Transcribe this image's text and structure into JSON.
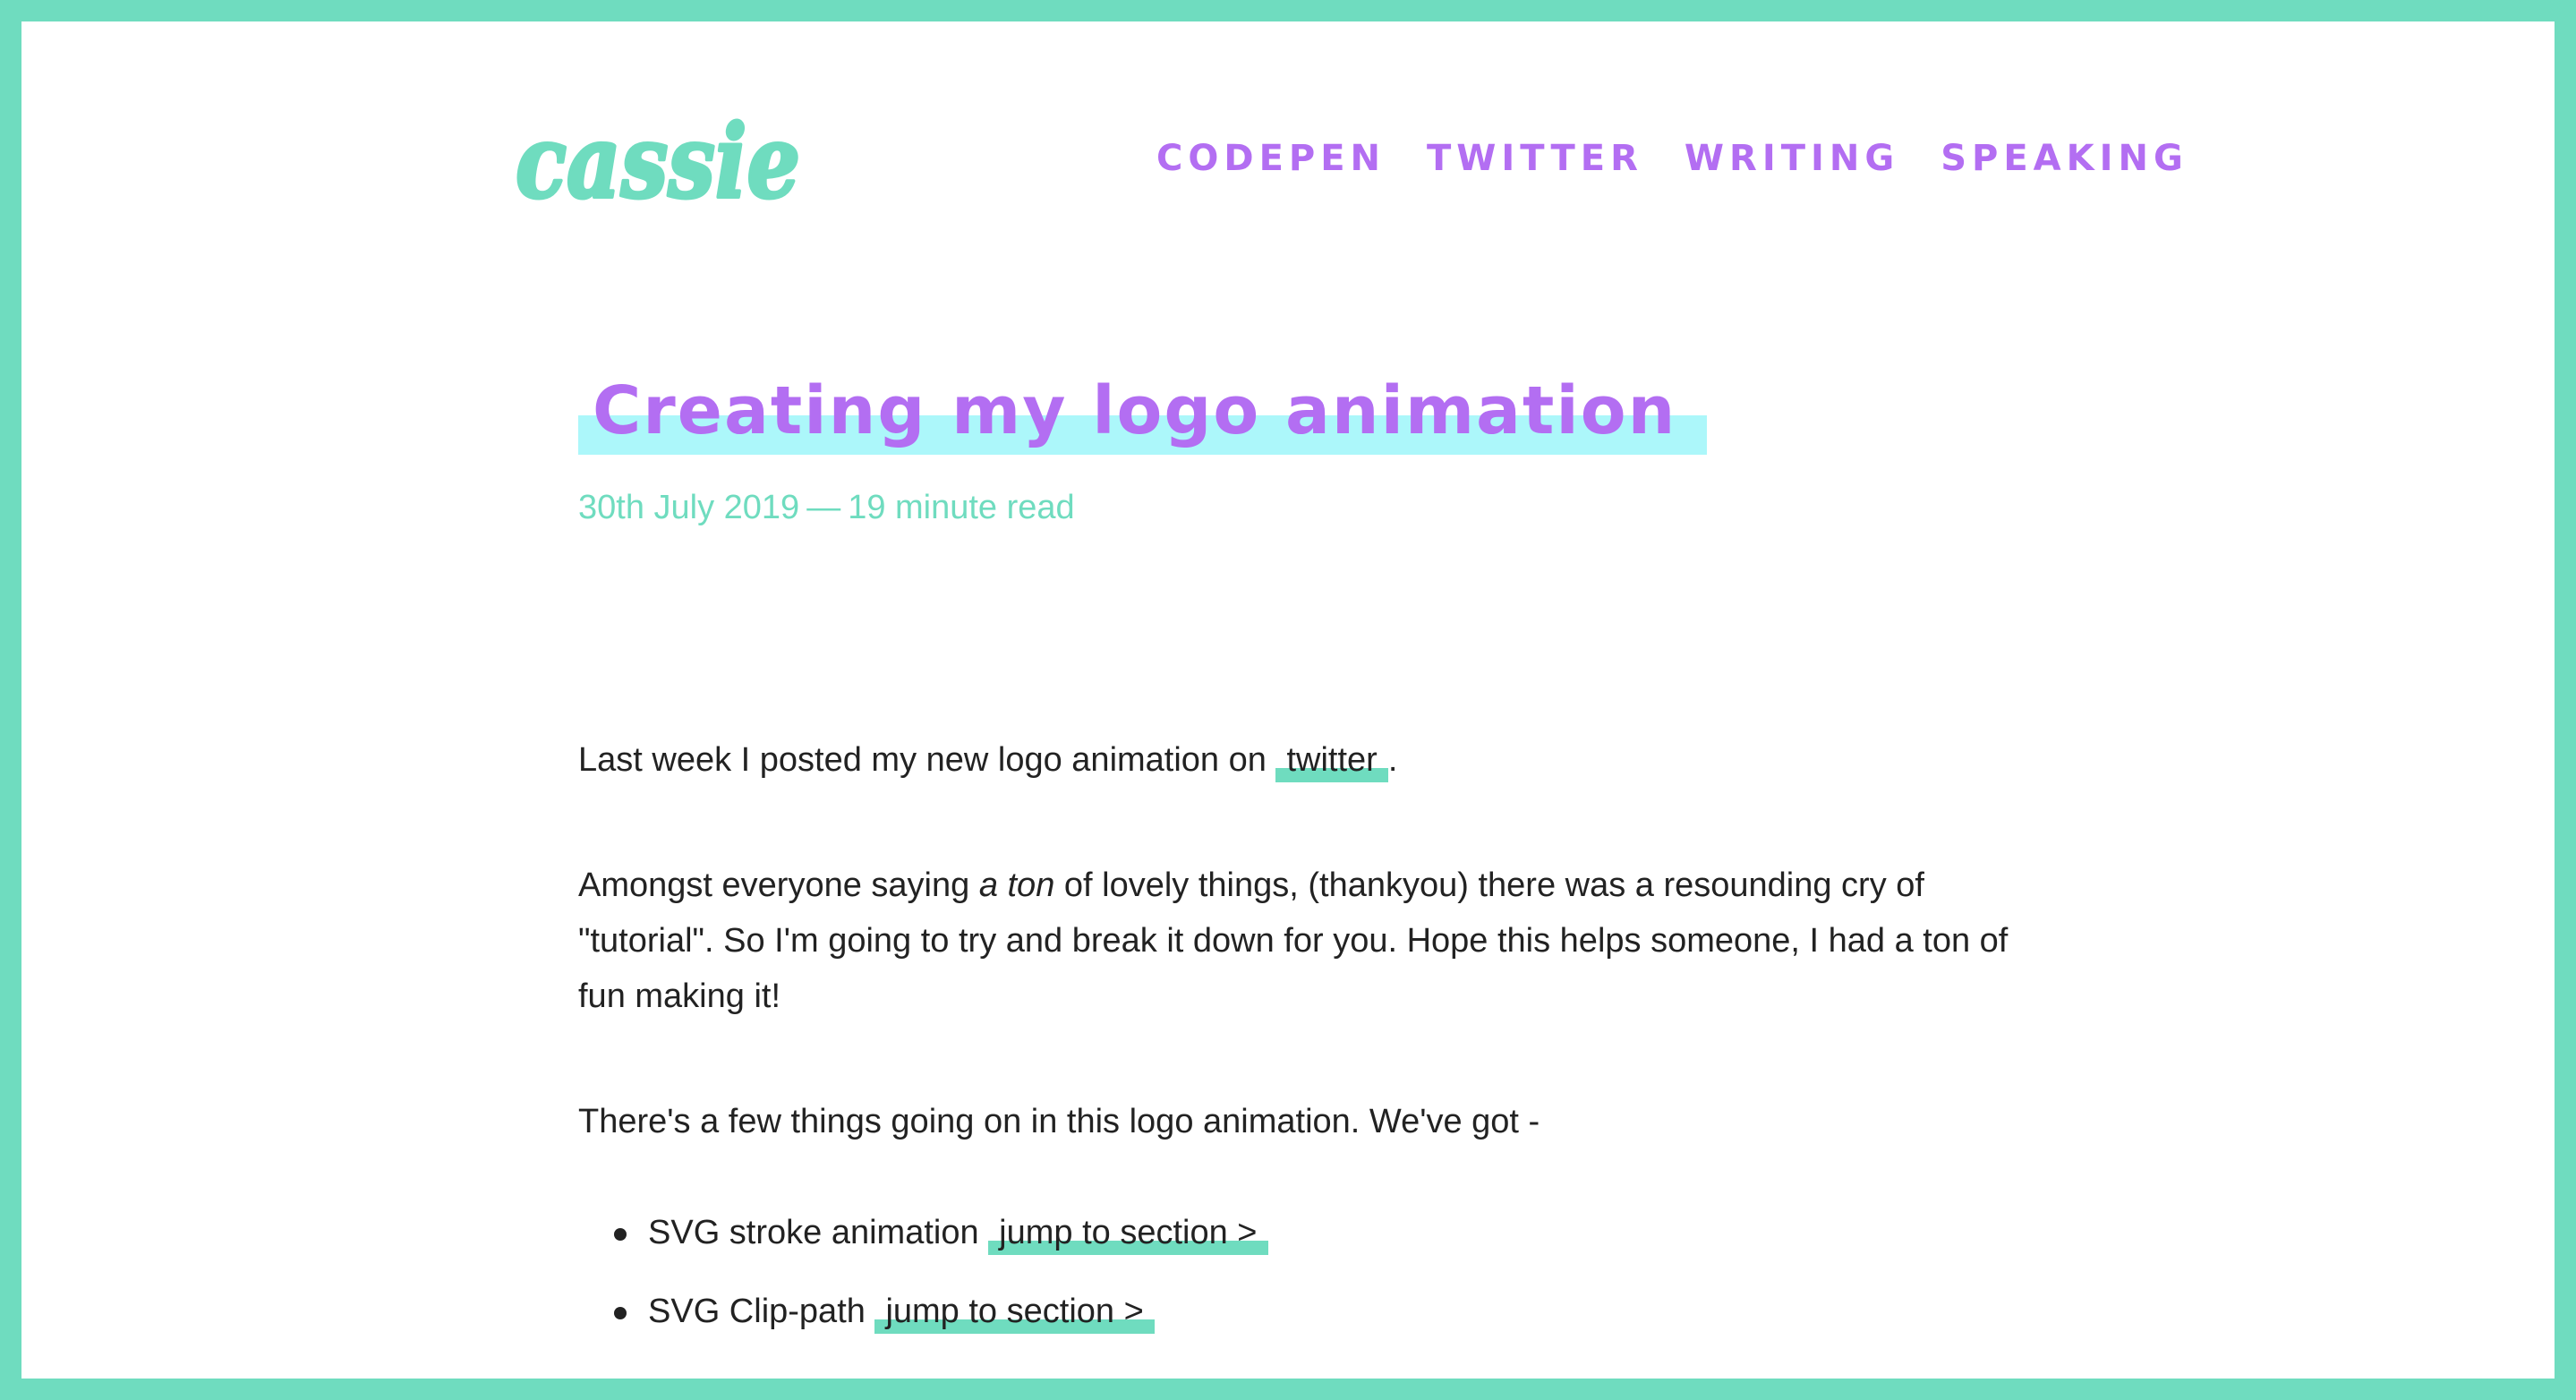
{
  "site": {
    "logo_text": "cassie",
    "brand_colors": {
      "border": "#6fdcbf",
      "accent": "#b36ef2",
      "title_highlight": "#acf7fa",
      "link_underline": "#6fdcbf"
    }
  },
  "nav": {
    "items": [
      {
        "label": "CODEPEN"
      },
      {
        "label": "TWITTER"
      },
      {
        "label": "WRITING"
      },
      {
        "label": "SPEAKING"
      }
    ]
  },
  "article": {
    "title": "Creating my logo animation",
    "date": "30th July 2019",
    "separator": "—",
    "read_time": "19 minute read",
    "p1": {
      "text": "Last week I posted my new logo animation on",
      "link": "twitter",
      "end": "."
    },
    "p2": {
      "before": "Amongst everyone saying",
      "emphasis": "a ton",
      "after": "of lovely things, (thankyou) there was a resounding cry of \"tutorial\". So I'm going to try and break it down for you. Hope this helps someone, I had a ton of fun making it!"
    },
    "p3": "There's a few things going on in this logo animation. We've got -",
    "features": [
      {
        "label": "SVG stroke animation",
        "link": "jump to section >"
      },
      {
        "label": "SVG Clip-path",
        "link": "jump to section >"
      }
    ]
  }
}
